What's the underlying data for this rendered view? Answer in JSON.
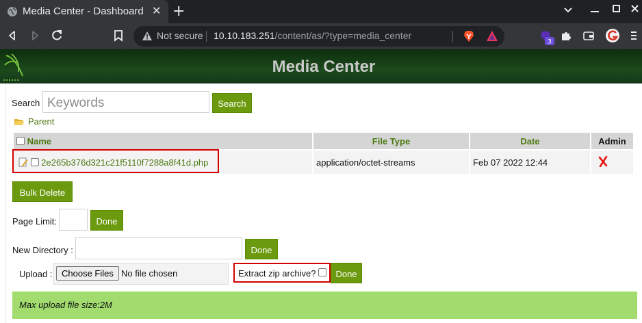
{
  "browser": {
    "tab_title": "Media Center - Dashboard",
    "tab_close": "✕",
    "new_tab": "+",
    "omnibox": {
      "security_label": "Not secure",
      "url_host": "10.10.183.251",
      "url_path": "/content/as/?type=media_center"
    },
    "extension_badge": "3"
  },
  "page": {
    "title": "Media Center",
    "search": {
      "placeholder": "Keywords",
      "label": "Search",
      "button": "Search"
    },
    "parent_link": "Parent",
    "table": {
      "columns": [
        "Name",
        "File Type",
        "Date",
        "Admin"
      ],
      "rows": [
        {
          "name": "2e265b376d321c21f5110f7288a8f41d.php",
          "file_type": "application/octet-streams",
          "date": "Feb 07 2022 12:44"
        }
      ]
    },
    "bulk_delete": "Bulk Delete",
    "page_limit": {
      "label": "Page Limit:",
      "value": "",
      "button": "Done"
    },
    "new_directory": {
      "label": "New Directory :",
      "value": "",
      "button": "Done"
    },
    "upload": {
      "label": "Upload :",
      "choose_button": "Choose Files",
      "status": "No file chosen",
      "extract_label": "Extract zip archive?",
      "button": "Done"
    },
    "max_upload": "Max upload file size:2M"
  },
  "colors": {
    "accent_green": "#6b9a0e",
    "link_green": "#4d7a14",
    "highlight_red": "#d40000",
    "message_bar": "#a2dc6e"
  }
}
